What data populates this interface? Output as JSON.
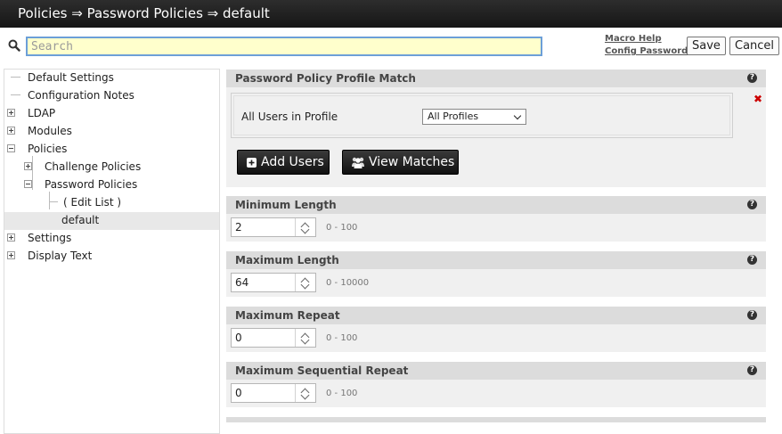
{
  "title": "Policies ⇒ Password Policies ⇒ default",
  "search": {
    "placeholder": "Search",
    "value": ""
  },
  "links": {
    "macro_help": "Macro Help",
    "config_password": "Config Password"
  },
  "buttons": {
    "save": "Save",
    "cancel": "Cancel"
  },
  "tree": {
    "default_settings": "Default Settings",
    "configuration_notes": "Configuration Notes",
    "ldap": "LDAP",
    "modules": "Modules",
    "policies": "Policies",
    "challenge_policies": "Challenge Policies",
    "password_policies": "Password Policies",
    "edit_list": "( Edit List )",
    "default": "default",
    "settings": "Settings",
    "display_text": "Display Text"
  },
  "profile_match": {
    "title": "Password Policy Profile Match",
    "label": "All Users in Profile",
    "selected": "All Profiles",
    "add_users": "Add Users",
    "view_matches": "View Matches"
  },
  "fields": [
    {
      "title": "Minimum Length",
      "value": "2",
      "range": "0 - 100"
    },
    {
      "title": "Maximum Length",
      "value": "64",
      "range": "0 - 10000"
    },
    {
      "title": "Maximum Repeat",
      "value": "0",
      "range": "0 - 100"
    },
    {
      "title": "Maximum Sequential Repeat",
      "value": "0",
      "range": "0 - 100"
    }
  ],
  "icons": {
    "search": "search-icon",
    "help": "help-icon",
    "delete": "close-icon",
    "add_users": "plus-square-icon",
    "view_matches": "users-icon"
  },
  "colors": {
    "titlebar": "#1f1f1f",
    "search_bg": "#ffffcc",
    "search_border": "#6c9fd8",
    "panel_bg": "#f0f0f0",
    "panel_head": "#dcdcdc",
    "delete": "#cc0000"
  }
}
